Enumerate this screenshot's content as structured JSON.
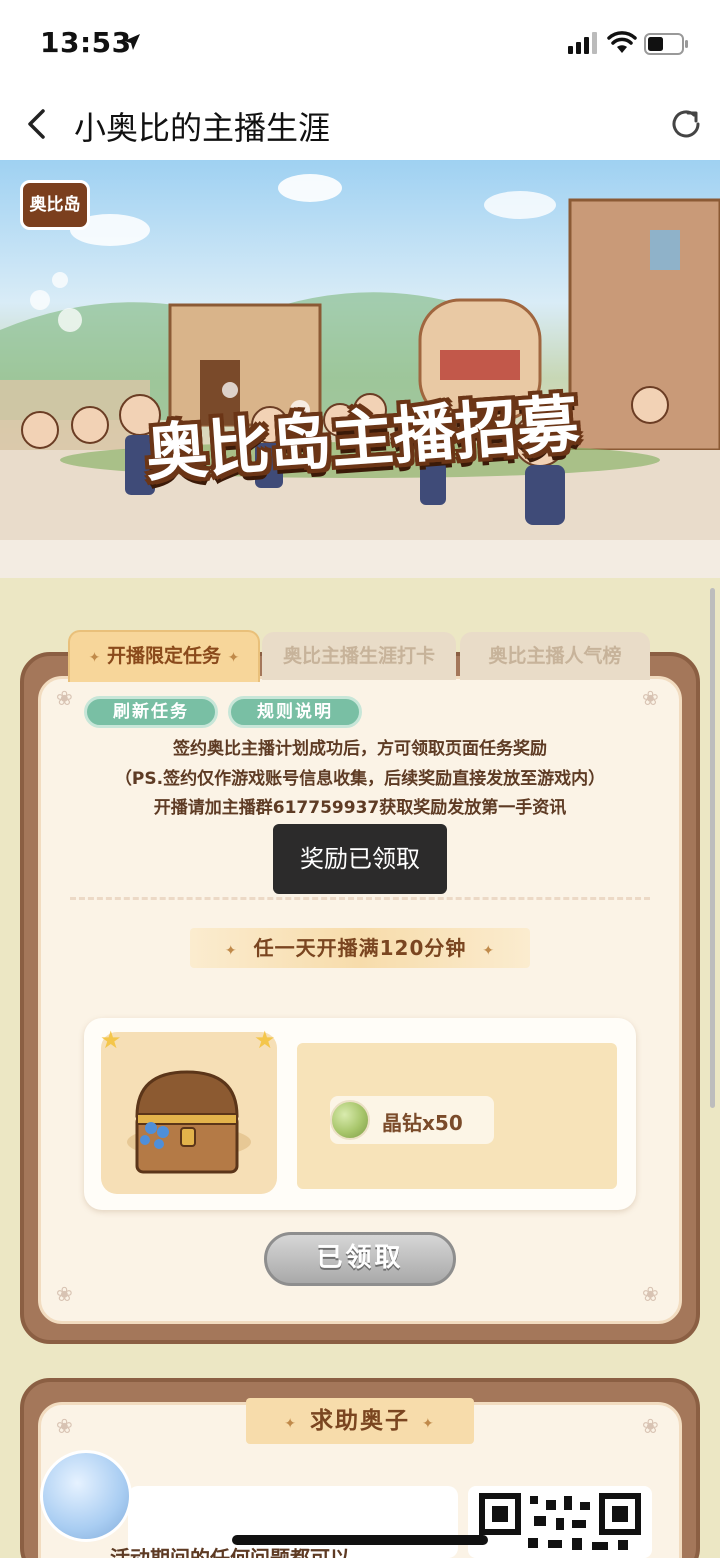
{
  "status_bar": {
    "time": "13:53",
    "icons": [
      "location-arrow-icon",
      "cellular-signal-icon",
      "wifi-icon",
      "battery-icon"
    ]
  },
  "nav": {
    "title": "小奥比的主播生涯",
    "back_icon": "chevron-left-icon",
    "refresh_icon": "refresh-icon"
  },
  "banner": {
    "logo_text": "奥比岛",
    "title": "奥比岛主播招募"
  },
  "tabs": [
    {
      "label": "开播限定任务",
      "active": true
    },
    {
      "label": "奥比主播生涯打卡",
      "active": false
    },
    {
      "label": "奥比主播人气榜",
      "active": false
    }
  ],
  "actions": {
    "refresh_tasks": "刷新任务",
    "rules": "规则说明"
  },
  "info": {
    "line1": "签约奥比主播计划成功后，方可领取页面任务奖励",
    "line2": "（PS.签约仅作游戏账号信息收集，后续奖励直接发放至游戏内）",
    "line3": "开播请加主播群617759937获取奖励发放第一手资讯"
  },
  "toast": {
    "message": "奖励已领取"
  },
  "task": {
    "title": "任一天开播满120分钟",
    "reward_item": "晶钻x50",
    "button_label": "已领取"
  },
  "help": {
    "title": "求助奥子",
    "text": "活动期间的任何问题都可以"
  },
  "colors": {
    "page_bg": "#ece7c4",
    "panel_border": "#a4775a",
    "pill_green": "#79bfa4",
    "text_brown": "#5e3b24",
    "toast_bg": "#2c2b2b"
  }
}
